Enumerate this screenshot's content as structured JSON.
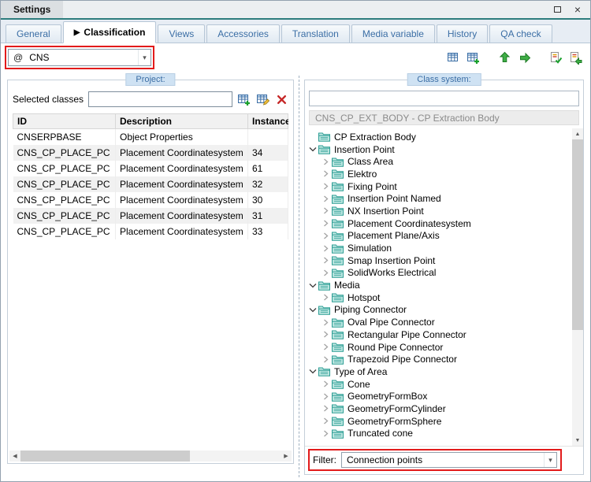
{
  "colors": {
    "accent_blue": "#3b6ea5",
    "annotation_red": "#e21b1b",
    "titlebar_accent": "#2e7d7d",
    "header_label_bg": "#cfe2f3",
    "folder_teal": "#2b9d94"
  },
  "window": {
    "title": "Settings",
    "controls": [
      "maximize-icon",
      "close-icon"
    ]
  },
  "tabs": {
    "active_marker": "▶",
    "items": [
      {
        "label": "General",
        "active": false
      },
      {
        "label": "Classification",
        "active": true
      },
      {
        "label": "Views",
        "active": false
      },
      {
        "label": "Accessories",
        "active": false
      },
      {
        "label": "Translation",
        "active": false
      },
      {
        "label": "Media variable",
        "active": false
      },
      {
        "label": "History",
        "active": false
      },
      {
        "label": "QA check",
        "active": false
      }
    ]
  },
  "toolbar": {
    "combo_icon": "@",
    "combo_value": "CNS",
    "icons": [
      "new-class-table-icon",
      "add-class-table-icon",
      "import-classes-icon",
      "export-classes-icon",
      "verify-classes-icon",
      "import-check-icon"
    ]
  },
  "project": {
    "header": "Project:",
    "selected_classes_label": "Selected classes",
    "selected_classes_value": "",
    "action_icons": [
      "add-class-icon",
      "edit-class-icon",
      "delete-class-icon"
    ],
    "table": {
      "columns": [
        "ID",
        "Description",
        "Instance"
      ],
      "rows": [
        {
          "id": "CNSERPBASE",
          "description": "Object Properties",
          "instance": ""
        },
        {
          "id": "CNS_CP_PLACE_PC",
          "description": "Placement Coordinatesystem",
          "instance": "34"
        },
        {
          "id": "CNS_CP_PLACE_PC",
          "description": "Placement Coordinatesystem",
          "instance": "61"
        },
        {
          "id": "CNS_CP_PLACE_PC",
          "description": "Placement Coordinatesystem",
          "instance": "32"
        },
        {
          "id": "CNS_CP_PLACE_PC",
          "description": "Placement Coordinatesystem",
          "instance": "30"
        },
        {
          "id": "CNS_CP_PLACE_PC",
          "description": "Placement Coordinatesystem",
          "instance": "31"
        },
        {
          "id": "CNS_CP_PLACE_PC",
          "description": "Placement Coordinatesystem",
          "instance": "33"
        }
      ]
    }
  },
  "class_system": {
    "header": "Class system:",
    "search_value": "",
    "selected_class": "CNS_CP_EXT_BODY - CP Extraction Body",
    "tree": [
      {
        "label": "CP Extraction Body",
        "indent": 0,
        "expander": "none"
      },
      {
        "label": "Insertion Point",
        "indent": 0,
        "expander": "expanded"
      },
      {
        "label": "Class Area",
        "indent": 1,
        "expander": "collapsed"
      },
      {
        "label": "Elektro",
        "indent": 1,
        "expander": "collapsed"
      },
      {
        "label": "Fixing Point",
        "indent": 1,
        "expander": "collapsed"
      },
      {
        "label": "Insertion Point Named",
        "indent": 1,
        "expander": "collapsed"
      },
      {
        "label": "NX Insertion Point",
        "indent": 1,
        "expander": "collapsed"
      },
      {
        "label": "Placement Coordinatesystem",
        "indent": 1,
        "expander": "collapsed"
      },
      {
        "label": "Placement Plane/Axis",
        "indent": 1,
        "expander": "collapsed"
      },
      {
        "label": "Simulation",
        "indent": 1,
        "expander": "collapsed"
      },
      {
        "label": "Smap Insertion Point",
        "indent": 1,
        "expander": "collapsed"
      },
      {
        "label": "SolidWorks Electrical",
        "indent": 1,
        "expander": "collapsed"
      },
      {
        "label": "Media",
        "indent": 0,
        "expander": "expanded"
      },
      {
        "label": "Hotspot",
        "indent": 1,
        "expander": "collapsed"
      },
      {
        "label": "Piping Connector",
        "indent": 0,
        "expander": "expanded"
      },
      {
        "label": "Oval Pipe Connector",
        "indent": 1,
        "expander": "collapsed"
      },
      {
        "label": "Rectangular Pipe Connector",
        "indent": 1,
        "expander": "collapsed"
      },
      {
        "label": "Round Pipe Connector",
        "indent": 1,
        "expander": "collapsed"
      },
      {
        "label": "Trapezoid Pipe Connector",
        "indent": 1,
        "expander": "collapsed"
      },
      {
        "label": "Type of Area",
        "indent": 0,
        "expander": "expanded"
      },
      {
        "label": "Cone",
        "indent": 1,
        "expander": "collapsed"
      },
      {
        "label": "GeometryFormBox",
        "indent": 1,
        "expander": "collapsed"
      },
      {
        "label": "GeometryFormCylinder",
        "indent": 1,
        "expander": "collapsed"
      },
      {
        "label": "GeometryFormSphere",
        "indent": 1,
        "expander": "collapsed"
      },
      {
        "label": "Truncated cone",
        "indent": 1,
        "expander": "collapsed"
      }
    ],
    "filter_label": "Filter:",
    "filter_value": "Connection points"
  }
}
